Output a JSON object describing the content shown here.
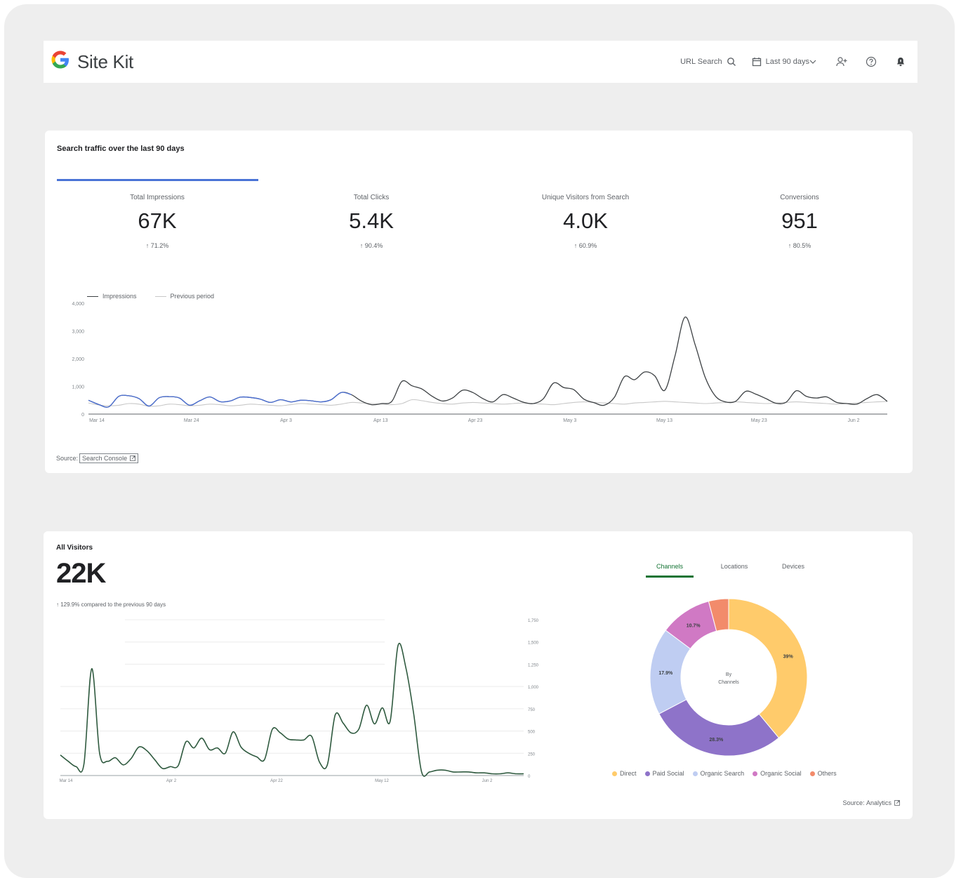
{
  "header": {
    "brand": "Site Kit",
    "logo_letter": "G",
    "url_search_label": "URL Search",
    "date_range_label": "Last 90 days",
    "icons": [
      "search-icon",
      "calendar-icon",
      "user-add-icon",
      "help-icon",
      "notification-icon"
    ]
  },
  "search_card": {
    "title": "Search traffic over the last 90 days",
    "metrics": [
      {
        "label": "Total Impressions",
        "value": "67K",
        "change": "↑ 71.2%"
      },
      {
        "label": "Total Clicks",
        "value": "5.4K",
        "change": "↑ 90.4%"
      },
      {
        "label": "Unique Visitors from Search",
        "value": "4.0K",
        "change": "↑ 60.9%"
      },
      {
        "label": "Conversions",
        "value": "951",
        "change": "↑ 80.5%"
      }
    ],
    "legend": {
      "current": "Impressions",
      "previous": "Previous period"
    },
    "source_prefix": "Source:",
    "source_link": "Search Console"
  },
  "visitors_card": {
    "title": "All Visitors",
    "total": "22K",
    "change": "↑ 129.9% compared to the previous 90 days",
    "tabs": [
      "Channels",
      "Locations",
      "Devices"
    ],
    "donut_center": [
      "By",
      "Channels"
    ],
    "source_prefix": "Source:",
    "source_link": "Analytics"
  },
  "colors": {
    "accent_blue": "#4a74d6",
    "accent_green": "#137333",
    "line_dark": "#3c4043",
    "visitors_line": "#2f5a3f"
  },
  "chart_data": [
    {
      "type": "line",
      "xlabel": "",
      "ylabel": "",
      "ylim": [
        0,
        4000
      ],
      "y_ticks": [
        "0",
        "1,000",
        "2,000",
        "3,000",
        "4,000"
      ],
      "x_ticks": [
        "Mar 14",
        "Mar 24",
        "Apr 3",
        "Apr 13",
        "Apr 23",
        "May 3",
        "May 13",
        "May 23",
        "Jun 2"
      ],
      "series": [
        {
          "name": "Impressions",
          "values": [
            500,
            350,
            260,
            640,
            660,
            560,
            290,
            590,
            630,
            580,
            320,
            480,
            620,
            450,
            470,
            610,
            600,
            540,
            420,
            520,
            440,
            500,
            480,
            440,
            520,
            780,
            700,
            470,
            340,
            380,
            460,
            1180,
            1020,
            900,
            640,
            470,
            580,
            860,
            780,
            560,
            440,
            700,
            580,
            430,
            380,
            560,
            1120,
            960,
            880,
            540,
            410,
            320,
            600,
            1350,
            1240,
            1520,
            1380,
            860,
            2090,
            3500,
            2500,
            1320,
            650,
            440,
            460,
            820,
            720,
            560,
            390,
            430,
            840,
            640,
            580,
            620,
            420,
            380,
            360,
            560,
            700,
            460
          ]
        },
        {
          "name": "Previous period",
          "values": [
            400,
            330,
            300,
            320,
            380,
            360,
            280,
            300,
            360,
            340,
            300,
            320,
            360,
            340,
            300,
            320,
            360,
            340,
            320,
            300,
            340,
            380,
            360,
            340,
            320,
            360,
            420,
            400,
            380,
            360,
            340,
            380,
            520,
            480,
            420,
            380,
            360,
            400,
            420,
            400,
            380,
            360,
            380,
            400,
            380,
            360,
            340,
            380,
            420,
            440,
            420,
            400,
            380,
            360,
            400,
            420,
            440,
            460,
            440,
            420,
            400,
            380,
            400,
            420,
            440,
            420,
            400,
            380,
            400,
            420,
            440,
            420,
            400,
            380,
            360,
            380,
            400,
            420,
            440,
            460
          ]
        }
      ]
    },
    {
      "type": "line",
      "xlabel": "",
      "ylabel": "",
      "ylim": [
        0,
        1750
      ],
      "y_ticks": [
        "0",
        "250",
        "500",
        "750",
        "1,000",
        "1,250",
        "1,500",
        "1,750"
      ],
      "x_ticks": [
        "Mar 14",
        "Apr 2",
        "Apr 22",
        "May 12",
        "Jun 2"
      ],
      "series": [
        {
          "name": "",
          "values": [
            230,
            160,
            100,
            130,
            1200,
            250,
            160,
            200,
            120,
            190,
            320,
            280,
            180,
            80,
            100,
            110,
            380,
            310,
            420,
            290,
            310,
            250,
            490,
            320,
            250,
            210,
            180,
            520,
            480,
            410,
            400,
            400,
            440,
            150,
            120,
            680,
            590,
            480,
            520,
            790,
            580,
            760,
            610,
            1460,
            1210,
            690,
            40,
            40,
            60,
            60,
            40,
            40,
            40,
            30,
            30,
            20,
            20,
            30,
            20,
            20
          ]
        }
      ]
    },
    {
      "type": "pie",
      "categories": [
        "Direct",
        "Paid Social",
        "Organic Search",
        "Organic Social",
        "Others"
      ],
      "values": [
        39,
        28.3,
        17.9,
        10.7,
        4.1
      ],
      "slice_labels": [
        "39%",
        "28.3%",
        "17.9%",
        "10.7%",
        ""
      ],
      "colors": [
        "#ffcb6b",
        "#8e73c9",
        "#bfcdf2",
        "#d079c4",
        "#f28b6b"
      ]
    }
  ]
}
